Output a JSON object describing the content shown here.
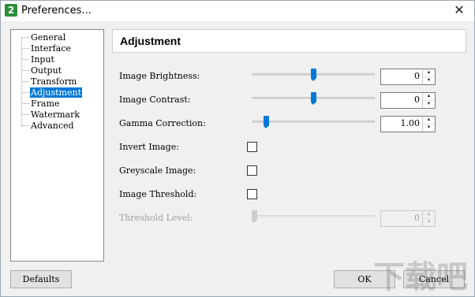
{
  "window": {
    "title": "Preferences...",
    "app_icon_text": "2"
  },
  "tree": {
    "items": [
      {
        "label": "General",
        "selected": false
      },
      {
        "label": "Interface",
        "selected": false
      },
      {
        "label": "Input",
        "selected": false
      },
      {
        "label": "Output",
        "selected": false
      },
      {
        "label": "Transform",
        "selected": false
      },
      {
        "label": "Adjustment",
        "selected": true
      },
      {
        "label": "Frame",
        "selected": false
      },
      {
        "label": "Watermark",
        "selected": false
      },
      {
        "label": "Advanced",
        "selected": false
      }
    ]
  },
  "panel": {
    "title": "Adjustment",
    "rows": {
      "brightness": {
        "label": "Image Brightness:",
        "value": "0",
        "level": 0.5
      },
      "contrast": {
        "label": "Image Contrast:",
        "value": "0",
        "level": 0.5
      },
      "gamma": {
        "label": "Gamma Correction:",
        "value": "1.00",
        "level": 0.1
      },
      "invert": {
        "label": "Invert Image:",
        "checked": false
      },
      "greyscale": {
        "label": "Greyscale Image:",
        "checked": false
      },
      "threshold": {
        "label": "Image Threshold:",
        "checked": false
      },
      "threshold_level": {
        "label": "Threshold Level:",
        "value": "0",
        "level": 0.0,
        "disabled": true
      }
    }
  },
  "buttons": {
    "defaults": "Defaults",
    "ok": "OK",
    "cancel": "Cancel"
  },
  "colors": {
    "accent": "#0078d7",
    "disabled_text": "#a0a0a0"
  }
}
